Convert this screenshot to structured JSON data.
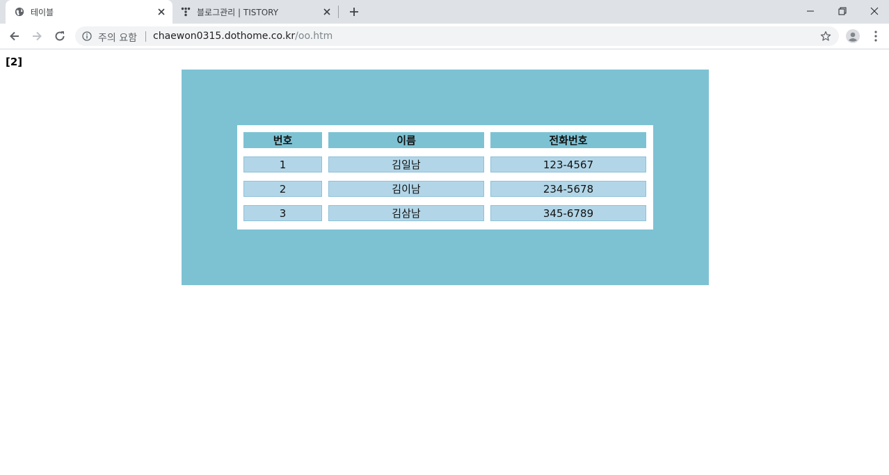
{
  "browser": {
    "tabs": [
      {
        "title": "테이블",
        "icon": "globe-icon",
        "active": true
      },
      {
        "title": "블로그관리 | TISTORY",
        "icon": "tistory-icon",
        "active": false
      }
    ],
    "address": {
      "security_label": "주의 요함",
      "url_host": "chaewon0315.dothome.co.kr",
      "url_path": "/oo.htm"
    }
  },
  "page": {
    "heading": "[2]",
    "table": {
      "headers": [
        "번호",
        "이름",
        "전화번호"
      ],
      "rows": [
        [
          "1",
          "김일남",
          "123-4567"
        ],
        [
          "2",
          "김이남",
          "234-5678"
        ],
        [
          "3",
          "김삼남",
          "345-6789"
        ]
      ]
    }
  },
  "colors": {
    "outer_background": "#7dc2d3",
    "header_cell": "#7dc2d3",
    "data_cell": "#b2d6e8"
  }
}
